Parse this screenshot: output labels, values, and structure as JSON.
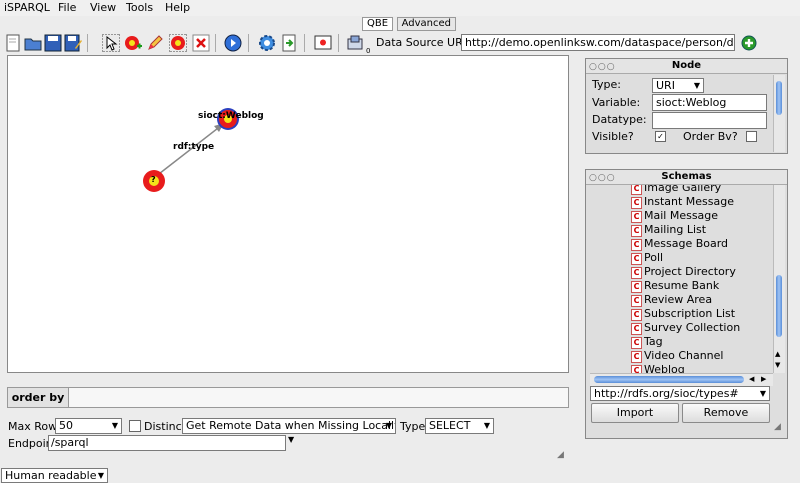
{
  "menu": {
    "app": "iSPARQL",
    "file": "File",
    "view": "View",
    "tools": "Tools",
    "help": "Help"
  },
  "tabs": {
    "qbe": "QBE",
    "advanced": "Advanced"
  },
  "toolbar": {
    "data_source_label": "Data Source URI",
    "data_source_value": "http://demo.openlinksw.com/dataspace/person/dem",
    "small_zero": "0"
  },
  "graph": {
    "node_target_label": "sioct:Weblog",
    "node_source_label": "?",
    "edge_label": "rdf:type"
  },
  "order_by": {
    "label": "order by"
  },
  "query_opts": {
    "max_rows_label": "Max Rows",
    "max_rows_value": "50",
    "distinct_label": "Distinct",
    "remote_data_value": "Get Remote Data when Missing Locally",
    "type_label": "Type",
    "type_value": "SELECT",
    "endpoint_label": "Endpoint",
    "endpoint_value": "/sparql"
  },
  "output_format": {
    "value": "Human readable"
  },
  "node_panel": {
    "title": "Node",
    "type_label": "Type:",
    "type_value": "URI",
    "variable_label": "Variable:",
    "variable_value": "sioct:Weblog",
    "datatype_label": "Datatype:",
    "datatype_value": "",
    "visible_label": "Visible?",
    "visible_checked": "✓",
    "order_label": "Order Bv?"
  },
  "schemas_panel": {
    "title": "Schemas",
    "items": [
      "Image Gallery",
      "Instant Message",
      "Mail Message",
      "Mailing List",
      "Message Board",
      "Poll",
      "Project Directory",
      "Resume Bank",
      "Review Area",
      "Subscription List",
      "Survey Collection",
      "Tag",
      "Video Channel",
      "Weblog"
    ],
    "url_value": "http://rdfs.org/sioc/types#",
    "import_label": "Import",
    "remove_label": "Remove"
  },
  "colors": {
    "node_outer": "#e81c1c",
    "node_inner": "#f3e41a",
    "node_selected_ring": "#2b3fbf",
    "accent_blue": "#2f6fd8"
  }
}
